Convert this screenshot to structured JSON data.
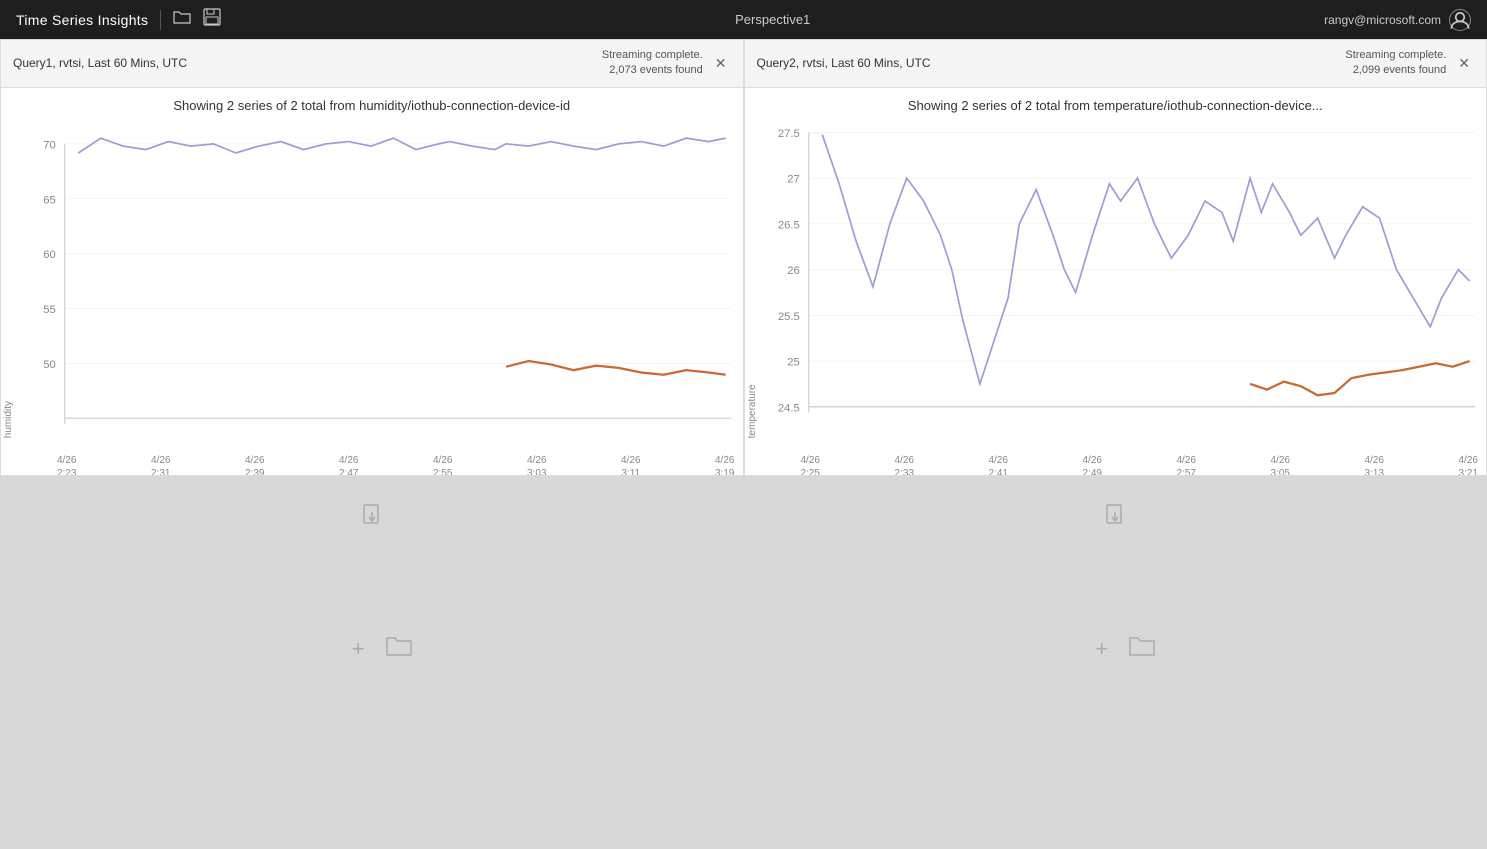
{
  "header": {
    "title": "Time Series Insights",
    "perspective": "Perspective1",
    "user": "rangv@microsoft.com",
    "open_icon": "📂",
    "save_icon": "💾"
  },
  "panels": [
    {
      "id": "panel1",
      "query_label": "Query1, rvtsi, Last 60 Mins, UTC",
      "streaming_status": "Streaming complete.",
      "events_found": "2,073 events found",
      "chart_title": "Showing 2 series of 2 total from humidity/iothub-connection-device-id",
      "y_axis_label": "humidity",
      "y_ticks": [
        "70",
        "65",
        "60",
        "55",
        "50"
      ],
      "x_ticks": [
        {
          "line1": "4/26",
          "line2": "2:23"
        },
        {
          "line1": "4/26",
          "line2": "2:31"
        },
        {
          "line1": "4/26",
          "line2": "2:39"
        },
        {
          "line1": "4/26",
          "line2": "2:47"
        },
        {
          "line1": "4/26",
          "line2": "2:55"
        },
        {
          "line1": "4/26",
          "line2": "3:03"
        },
        {
          "line1": "4/26",
          "line2": "3:11"
        },
        {
          "line1": "4/26",
          "line2": "3:19"
        }
      ],
      "type": "humidity"
    },
    {
      "id": "panel2",
      "query_label": "Query2, rvtsi, Last 60 Mins, UTC",
      "streaming_status": "Streaming complete.",
      "events_found": "2,099 events found",
      "chart_title": "Showing 2 series of 2 total from temperature/iothub-connection-device...",
      "y_axis_label": "temperature",
      "y_ticks": [
        "27.5",
        "27",
        "26.5",
        "26",
        "25.5",
        "25",
        "24.5"
      ],
      "x_ticks": [
        {
          "line1": "4/26",
          "line2": "2:25"
        },
        {
          "line1": "4/26",
          "line2": "2:33"
        },
        {
          "line1": "4/26",
          "line2": "2:41"
        },
        {
          "line1": "4/26",
          "line2": "2:49"
        },
        {
          "line1": "4/26",
          "line2": "2:57"
        },
        {
          "line1": "4/26",
          "line2": "3:05"
        },
        {
          "line1": "4/26",
          "line2": "3:13"
        },
        {
          "line1": "4/26",
          "line2": "3:21"
        }
      ],
      "type": "temperature"
    }
  ],
  "empty_panels": [
    {
      "id": "empty1"
    },
    {
      "id": "empty2"
    }
  ]
}
